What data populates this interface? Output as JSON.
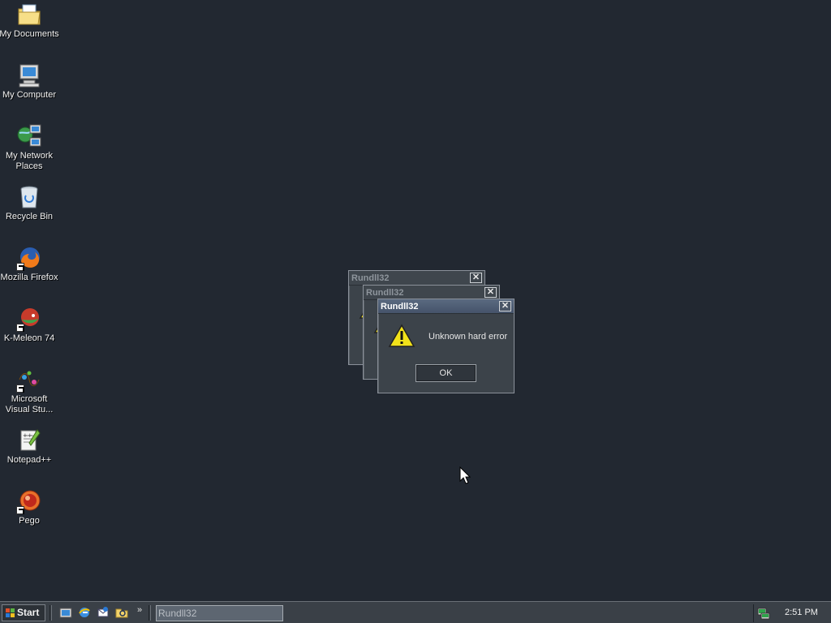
{
  "desktop": {
    "icons": [
      {
        "label": "My Documents",
        "icon": "folder-documents-icon"
      },
      {
        "label": "My Computer",
        "icon": "computer-icon"
      },
      {
        "label": "My Network Places",
        "icon": "network-places-icon"
      },
      {
        "label": "Recycle Bin",
        "icon": "recycle-bin-icon"
      },
      {
        "label": "Mozilla Firefox",
        "icon": "firefox-icon"
      },
      {
        "label": "K-Meleon 74",
        "icon": "k-meleon-icon"
      },
      {
        "label": "Microsoft Visual Stu...",
        "icon": "visual-studio-icon"
      },
      {
        "label": "Notepad++",
        "icon": "notepadpp-icon"
      },
      {
        "label": "Pego",
        "icon": "pego-icon"
      }
    ]
  },
  "dialogs": [
    {
      "title": "Rundll32"
    },
    {
      "title": "Rundll32"
    },
    {
      "title": "Rundll32",
      "message": "Unknown hard error",
      "ok_label": "OK"
    }
  ],
  "taskbar": {
    "start_label": "Start",
    "chevron": "»",
    "task_label": "Rundll32",
    "clock": "2:51 PM"
  },
  "colors": {
    "desktop": "#222831",
    "taskbar": "#3a4047",
    "active_title": "#4f5e74"
  }
}
